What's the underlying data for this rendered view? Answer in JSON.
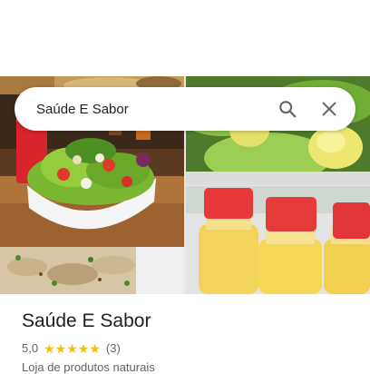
{
  "search": {
    "query": "Saúde E Sabor",
    "search_icon": "search-icon",
    "close_icon": "close-icon"
  },
  "gallery": {
    "photos": [
      "food-photo",
      "salad-photo",
      "pasta-photo",
      "greens-photo",
      "juice-bottles-photo"
    ]
  },
  "place": {
    "name": "Saúde E Sabor",
    "rating": "5,0",
    "stars": 5,
    "review_count": "(3)",
    "category": "Loja de produtos naturais"
  },
  "colors": {
    "star": "#fbbc04",
    "text_primary": "#202124",
    "text_secondary": "#5f6368"
  }
}
